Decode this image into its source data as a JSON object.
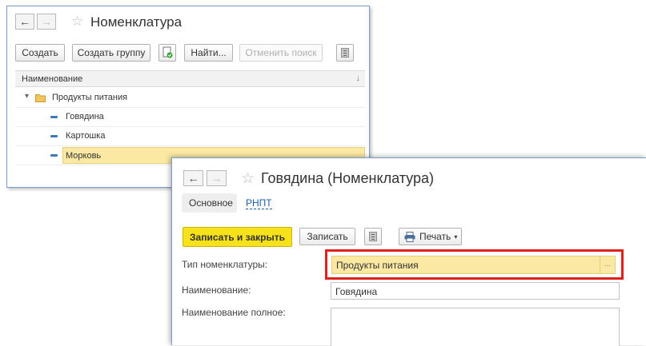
{
  "list_window": {
    "back_arrow": "←",
    "forward_arrow": "→",
    "star": "☆",
    "title": "Номенклатура",
    "toolbar": {
      "create": "Создать",
      "create_group": "Создать группу",
      "find": "Найти...",
      "cancel_search": "Отменить поиск"
    },
    "column_header": "Наименование",
    "sort_indicator": "↓",
    "rows": [
      {
        "label": "Продукты питания",
        "kind": "group",
        "expander": "▾"
      },
      {
        "label": "Говядина",
        "kind": "item"
      },
      {
        "label": "Картошка",
        "kind": "item"
      },
      {
        "label": "Морковь",
        "kind": "item",
        "selected": true
      }
    ]
  },
  "item_window": {
    "back_arrow": "←",
    "forward_arrow": "→",
    "star": "☆",
    "title": "Говядина (Номенклатура)",
    "tabs": {
      "main": "Основное",
      "rnpt": "РНПТ"
    },
    "toolbar": {
      "save_close": "Записать и закрыть",
      "save": "Записать",
      "print": "Печать",
      "print_arrow": "▾"
    },
    "fields": {
      "type_label": "Тип номенклатуры:",
      "type_value": "Продукты питания",
      "select_dots": "...",
      "name_label": "Наименование:",
      "name_value": "Говядина",
      "full_name_label": "Наименование полное:"
    },
    "colors": {
      "accent_yellow": "#f7e11b",
      "highlight_red": "#e0201a",
      "selection": "#fbe9a3"
    }
  }
}
